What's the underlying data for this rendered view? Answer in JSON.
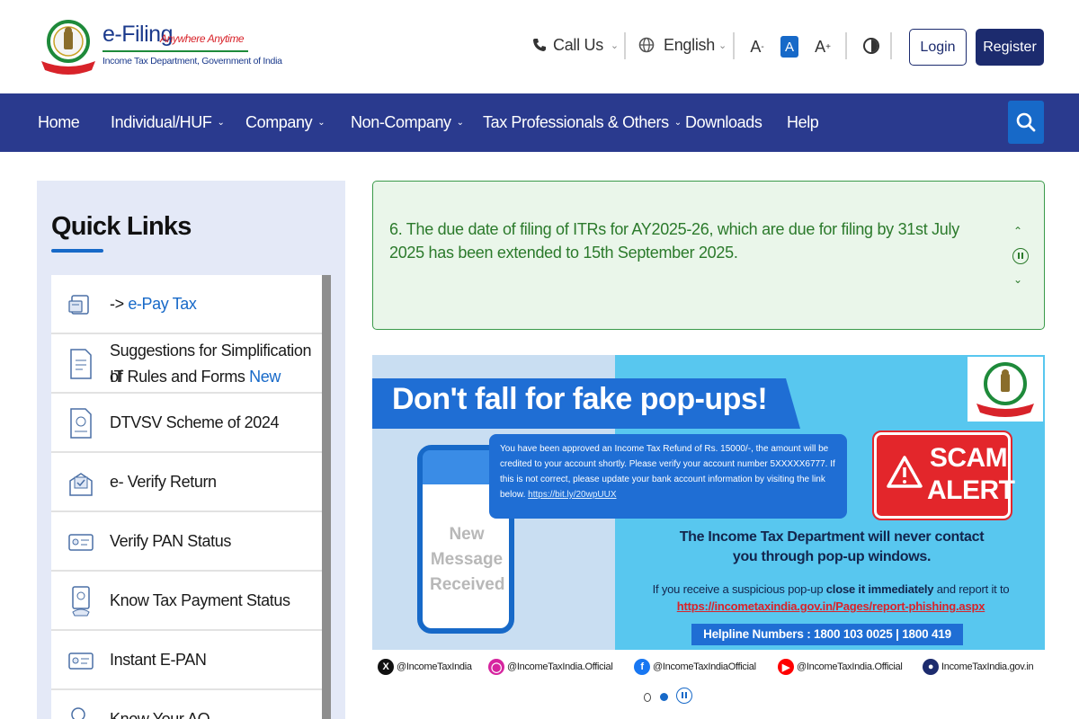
{
  "header": {
    "brand_name": "e-Filing",
    "brand_tagline": "Anywhere Anytime",
    "brand_dept": "Income Tax Department, Government of India",
    "call_us": "Call Us",
    "language": "English",
    "font_decrease": "A",
    "font_normal": "A",
    "font_increase": "A",
    "login": "Login",
    "register": "Register"
  },
  "nav": {
    "items": [
      {
        "label": "Home",
        "dropdown": false
      },
      {
        "label": "Individual/HUF",
        "dropdown": true
      },
      {
        "label": "Company",
        "dropdown": true
      },
      {
        "label": "Non-Company",
        "dropdown": true
      },
      {
        "label": "Tax Professionals & Others",
        "dropdown": true
      },
      {
        "label": "Downloads",
        "dropdown": false
      },
      {
        "label": "Help",
        "dropdown": false
      }
    ],
    "search_icon": "search-icon"
  },
  "quick_links": {
    "title": "Quick Links",
    "items": [
      {
        "prefix": "-> ",
        "label": "e-Pay Tax",
        "suffix": "",
        "icon": "epay-icon"
      },
      {
        "label": "Suggestions for Simplification of",
        "label2": "IT Rules and Forms",
        "badge": "New",
        "icon": "document-icon"
      },
      {
        "label": "DTVSV Scheme of 2024",
        "icon": "dtvsv-icon"
      },
      {
        "label": "e- Verify Return",
        "icon": "verify-return-icon"
      },
      {
        "label": "Verify PAN Status",
        "icon": "pan-card-icon"
      },
      {
        "label": "Know Tax Payment Status",
        "icon": "tax-payment-icon"
      },
      {
        "label": "Instant E-PAN",
        "icon": "epan-icon"
      },
      {
        "label": "Know Your AO",
        "icon": "know-ao-icon"
      }
    ]
  },
  "notice": {
    "text": "6. The due date of filing of ITRs for AY2025-26, which are due for filing by 31st July 2025 has been extended to 15th September 2025.",
    "up_icon": "chevron-up-icon",
    "pause_icon": "pause-icon",
    "down_icon": "chevron-down-icon"
  },
  "banner": {
    "headline": "Don't fall for fake pop-ups!",
    "phone_message": "New Message Received",
    "popup_text": "You have been approved an Income Tax Refund of Rs. 15000/-, the amount will be credited to your account shortly. Please verify your account number 5XXXXX6777. If this is not correct, please update your bank account information by visiting the link below.",
    "popup_link": "https://bit.ly/20wpUUX",
    "scam_alert": "SCAM ALERT",
    "never_contact": "The Income Tax Department will never contact you through pop-up windows.",
    "report_prefix": "If you receive a suspicious pop-up",
    "report_bold": "close it immediately",
    "report_suffix": "and report it to",
    "report_link": "https://incometaxindia.gov.in/Pages/report-phishing.aspx",
    "helpline": "Helpline Numbers : 1800 103 0025 | 1800 419 0025",
    "socials": [
      {
        "icon": "x-icon",
        "handle": "@IncomeTaxIndia",
        "color": "#111111"
      },
      {
        "icon": "instagram-icon",
        "handle": "@IncomeTaxIndia.Official",
        "color": "#d6249f"
      },
      {
        "icon": "facebook-icon",
        "handle": "@IncomeTaxIndiaOfficial",
        "color": "#1877f2"
      },
      {
        "icon": "youtube-icon",
        "handle": "@IncomeTaxIndia.Official",
        "color": "#ff0000"
      },
      {
        "icon": "web-icon",
        "handle": "IncomeTaxIndia.gov.in",
        "color": "#1c2b6e"
      }
    ]
  },
  "carousel": {
    "current_slide": 2,
    "total_slides": 2
  },
  "colors": {
    "nav_bg": "#2a3a8e",
    "accent_blue": "#1769c8",
    "notice_green": "#2b7a2b",
    "alert_red": "#e3262b"
  }
}
